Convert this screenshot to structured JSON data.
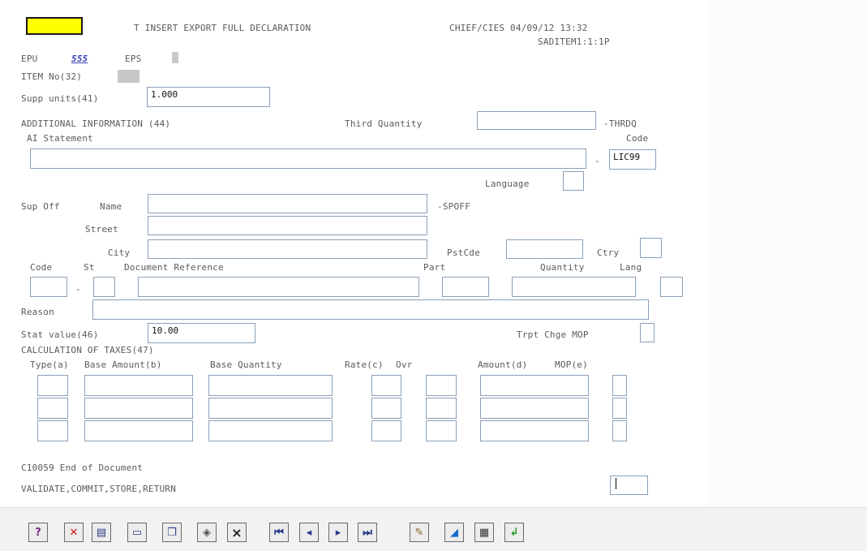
{
  "header": {
    "title": "T INSERT EXPORT FULL DECLARATION",
    "system": "CHIEF/CIES 04/09/12 13:32",
    "screen_id": "SADITEM1:1:1P"
  },
  "epu": {
    "label": "EPU",
    "value": "555",
    "eps_label": "EPS"
  },
  "item_no_label": "ITEM No(32)",
  "supp_units": {
    "label": "Supp units(41)",
    "value": "1.000"
  },
  "additional_info": {
    "label": "ADDITIONAL INFORMATION (44)",
    "third_quantity_label": "Third Quantity",
    "third_quantity_suffix": "-THRDQ",
    "ai_statement_label": "AI Statement",
    "code_label": "Code",
    "dash": "-",
    "code_value": "LIC99",
    "language_label": "Language"
  },
  "sup_off": {
    "label": "Sup Off",
    "name_label": "Name",
    "name_suffix": "-SPOFF",
    "street_label": "Street",
    "city_label": "City",
    "pstcde_label": "PstCde",
    "ctry_label": "Ctry"
  },
  "document": {
    "code_label": "Code",
    "st_label": "St",
    "docref_label": "Document Reference",
    "part_label": "Part",
    "quantity_label": "Quantity",
    "lang_label": "Lang",
    "dash": "-",
    "reason_label": "Reason"
  },
  "stat_value": {
    "label": "Stat value(46)",
    "value": "10.00",
    "trpt_label": "Trpt Chge MOP"
  },
  "taxes": {
    "label": "CALCULATION OF TAXES(47)",
    "col_type": "Type(a)",
    "col_base_amount": "Base Amount(b)",
    "col_base_quantity": "Base Quantity",
    "col_rate": "Rate(c)",
    "col_ovr": "Ovr",
    "col_amount": "Amount(d)",
    "col_mop": "MOP(e)"
  },
  "messages": {
    "end_of_document": "C10059 End of Document",
    "actions": "VALIDATE,COMMIT,STORE,RETURN"
  },
  "toolbar": {
    "buttons": [
      {
        "name": "help-book-icon",
        "glyph": "?"
      },
      {
        "name": "delete-field-icon",
        "glyph": "✕"
      },
      {
        "name": "insert-field-icon",
        "glyph": "▤"
      },
      {
        "name": "edit-field-icon",
        "glyph": "▭"
      },
      {
        "name": "copy-record-icon",
        "glyph": "❐"
      },
      {
        "name": "clear-icon",
        "glyph": "◈"
      },
      {
        "name": "cancel-icon",
        "glyph": "×"
      },
      {
        "name": "first-page-icon",
        "glyph": "⏮"
      },
      {
        "name": "previous-page-icon",
        "glyph": "◂"
      },
      {
        "name": "next-page-icon",
        "glyph": "▸"
      },
      {
        "name": "last-page-icon",
        "glyph": "⏭"
      },
      {
        "name": "pen-icon",
        "glyph": "✎"
      },
      {
        "name": "paint-icon",
        "glyph": "◢"
      },
      {
        "name": "print-icon",
        "glyph": "▦"
      },
      {
        "name": "return-arrow-icon",
        "glyph": "↲"
      }
    ]
  },
  "colors": {
    "marker": "#ffff00",
    "field_border": "#8aa0b8",
    "label_text": "#5a5a5a",
    "epu_value": "#3b45b8"
  }
}
